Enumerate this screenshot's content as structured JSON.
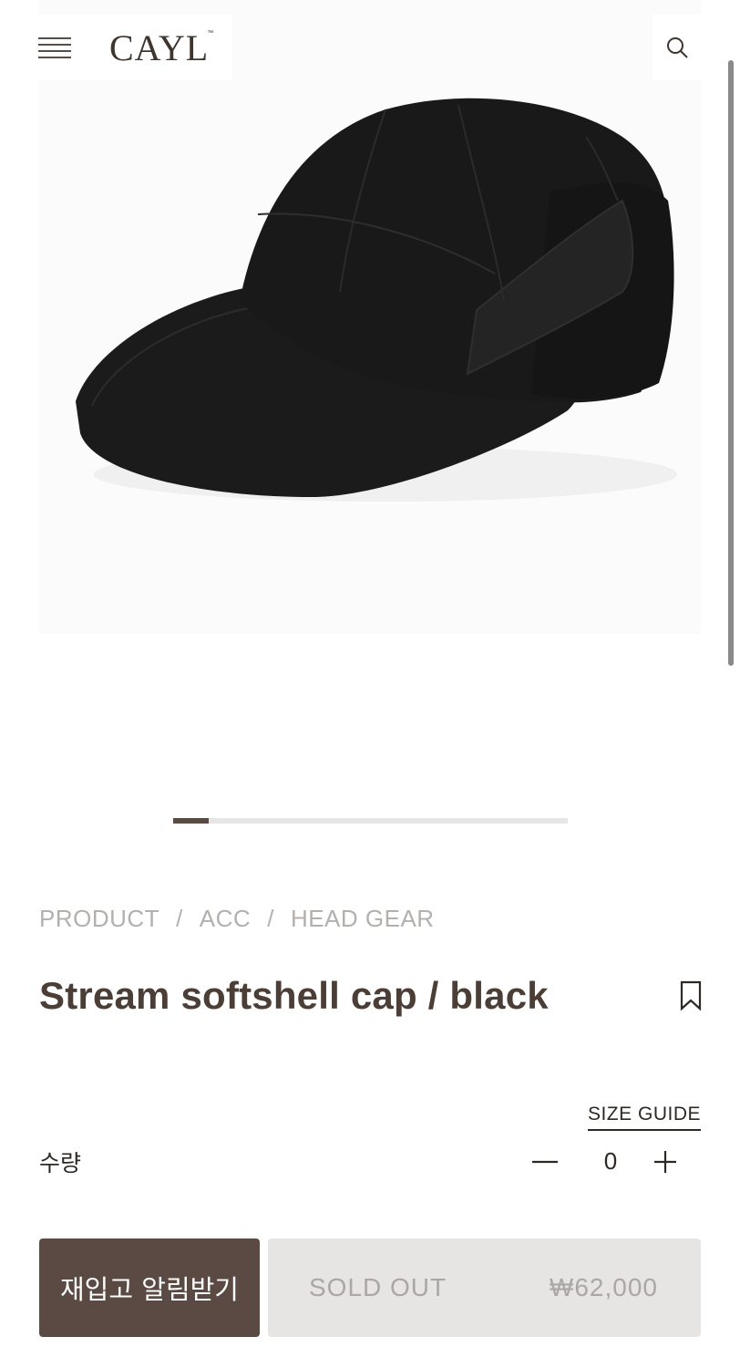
{
  "header": {
    "logo": "CAYL",
    "logo_mark": "™",
    "menu_icon": "menu-icon",
    "search_icon": "search-icon"
  },
  "gallery": {
    "image": "black softshell cap",
    "progress_fraction": 0.09
  },
  "breadcrumb": {
    "items": [
      "PRODUCT",
      "ACC",
      "HEAD GEAR"
    ],
    "separator": "/"
  },
  "product": {
    "title": "Stream softshell cap / black",
    "bookmark_icon": "bookmark-icon",
    "size_guide_label": "SIZE GUIDE",
    "quantity_label": "수량",
    "quantity_value": "0",
    "minus_icon": "minus-icon",
    "plus_icon": "plus-icon",
    "restock_button": "재입고 알림받기",
    "sold_out_label": "SOLD OUT",
    "price": "₩62,000"
  },
  "colors": {
    "brand_brown": "#5a4a43",
    "text": "#4b3e37",
    "muted": "#aaa7a4",
    "soldout_bg": "#e6e5e4"
  }
}
